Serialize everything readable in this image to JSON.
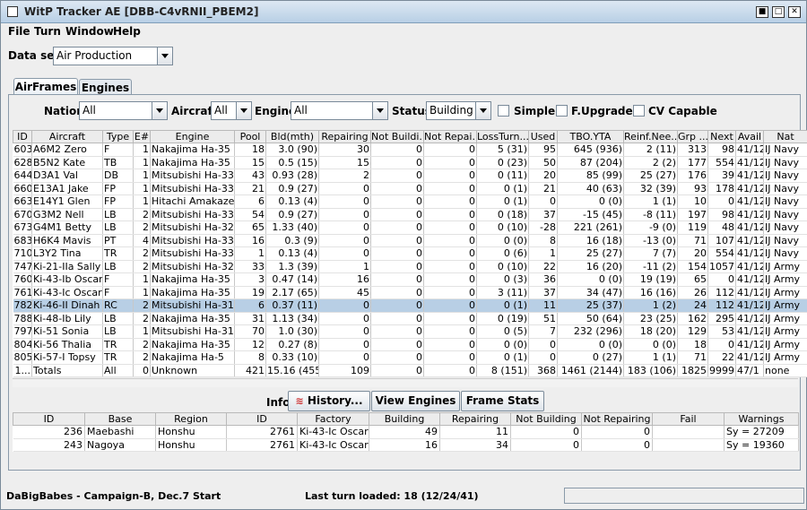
{
  "window": {
    "title": "WitP Tracker AE [DBB-C4vRNII_PBEM2]"
  },
  "menu": [
    "File",
    "Turn",
    "Window",
    "Help"
  ],
  "dataset": {
    "label": "Data set:",
    "value": "Air Production"
  },
  "tabs": [
    {
      "label": "AirFrames",
      "selected": true
    },
    {
      "label": "Engines",
      "selected": false
    }
  ],
  "filters": {
    "nation_label": "Nation:",
    "nation_value": "All",
    "aircraft_label": "Aircraft:",
    "aircraft_value": "All",
    "engine_label": "Engine:",
    "engine_value": "All",
    "status_label": "Status:",
    "status_value": "Building",
    "simple_label": "Simple",
    "fupgrades_label": "F.Upgrades",
    "cvcapable_label": "CV Capable"
  },
  "table": {
    "columns": [
      "ID",
      "Aircraft",
      "Type",
      "E#",
      "Engine",
      "Pool",
      "Bld(mth)",
      "Repairing",
      "Not Buildi...",
      "Not Repai...",
      "LossTurn...",
      "Used",
      "TBO.YTA",
      "Reinf.Nee...",
      "Grp ...",
      "Next",
      "Avail",
      "Nat"
    ],
    "selected_row": 12,
    "rows": [
      [
        "603",
        "A6M2 Zero",
        "F",
        "1",
        "Nakajima Ha-35",
        "18",
        "3.0 (90)",
        "30",
        "0",
        "0",
        "5 (31)",
        "95",
        "645 (936)",
        "2 (11)",
        "313",
        "98",
        "41/12",
        "IJ Navy"
      ],
      [
        "628",
        "B5N2 Kate",
        "TB",
        "1",
        "Nakajima Ha-35",
        "15",
        "0.5 (15)",
        "15",
        "0",
        "0",
        "0 (23)",
        "50",
        "87 (204)",
        "2 (2)",
        "177",
        "554",
        "41/12",
        "IJ Navy"
      ],
      [
        "644",
        "D3A1 Val",
        "DB",
        "1",
        "Mitsubishi Ha-33",
        "43",
        "0.93 (28)",
        "2",
        "0",
        "0",
        "0 (11)",
        "20",
        "85 (99)",
        "25 (27)",
        "176",
        "39",
        "41/12",
        "IJ Navy"
      ],
      [
        "660",
        "E13A1 Jake",
        "FP",
        "1",
        "Mitsubishi Ha-33",
        "21",
        "0.9 (27)",
        "0",
        "0",
        "0",
        "0 (1)",
        "21",
        "40 (63)",
        "32 (39)",
        "93",
        "178",
        "41/12",
        "IJ Navy"
      ],
      [
        "663",
        "E14Y1 Glen",
        "FP",
        "1",
        "Hitachi Amakaze",
        "6",
        "0.13 (4)",
        "0",
        "0",
        "0",
        "0 (1)",
        "0",
        "0 (0)",
        "1 (1)",
        "10",
        "0",
        "41/12",
        "IJ Navy"
      ],
      [
        "670",
        "G3M2 Nell",
        "LB",
        "2",
        "Mitsubishi Ha-33",
        "54",
        "0.9 (27)",
        "0",
        "0",
        "0",
        "0 (18)",
        "37",
        "-15 (45)",
        "-8 (11)",
        "197",
        "98",
        "41/12",
        "IJ Navy"
      ],
      [
        "673",
        "G4M1 Betty",
        "LB",
        "2",
        "Mitsubishi Ha-32",
        "65",
        "1.33 (40)",
        "0",
        "0",
        "0",
        "0 (10)",
        "-28",
        "221 (261)",
        "-9 (0)",
        "119",
        "48",
        "41/12",
        "IJ Navy"
      ],
      [
        "683",
        "H6K4 Mavis",
        "PT",
        "4",
        "Mitsubishi Ha-33",
        "16",
        "0.3 (9)",
        "0",
        "0",
        "0",
        "0 (0)",
        "8",
        "16 (18)",
        "-13 (0)",
        "71",
        "107",
        "41/12",
        "IJ Navy"
      ],
      [
        "710",
        "L3Y2 Tina",
        "TR",
        "2",
        "Mitsubishi Ha-33",
        "1",
        "0.13 (4)",
        "0",
        "0",
        "0",
        "0 (6)",
        "1",
        "25 (27)",
        "7 (7)",
        "20",
        "554",
        "41/12",
        "IJ Navy"
      ],
      [
        "747",
        "Ki-21-IIa Sally",
        "LB",
        "2",
        "Mitsubishi Ha-32",
        "33",
        "1.3 (39)",
        "1",
        "0",
        "0",
        "0 (10)",
        "22",
        "16 (20)",
        "-11 (2)",
        "154",
        "1057",
        "41/12",
        "IJ Army"
      ],
      [
        "760",
        "Ki-43-Ib Oscar",
        "F",
        "1",
        "Nakajima Ha-35",
        "3",
        "0.47 (14)",
        "16",
        "0",
        "0",
        "0 (3)",
        "36",
        "0 (0)",
        "19 (19)",
        "65",
        "0",
        "41/12",
        "IJ Army"
      ],
      [
        "761",
        "Ki-43-Ic Oscar",
        "F",
        "1",
        "Nakajima Ha-35",
        "19",
        "2.17 (65)",
        "45",
        "0",
        "0",
        "3 (11)",
        "37",
        "34 (47)",
        "16 (16)",
        "26",
        "112",
        "41/12",
        "IJ Army"
      ],
      [
        "782",
        "Ki-46-II Dinah",
        "RC",
        "2",
        "Mitsubishi Ha-31",
        "6",
        "0.37 (11)",
        "0",
        "0",
        "0",
        "0 (1)",
        "11",
        "25 (37)",
        "1 (2)",
        "24",
        "112",
        "41/12",
        "IJ Army"
      ],
      [
        "788",
        "Ki-48-Ib Lily",
        "LB",
        "2",
        "Nakajima Ha-35",
        "31",
        "1.13 (34)",
        "0",
        "0",
        "0",
        "0 (19)",
        "51",
        "50 (64)",
        "23 (25)",
        "162",
        "295",
        "41/12",
        "IJ Army"
      ],
      [
        "797",
        "Ki-51 Sonia",
        "LB",
        "1",
        "Mitsubishi Ha-31",
        "70",
        "1.0 (30)",
        "0",
        "0",
        "0",
        "0 (5)",
        "7",
        "232 (296)",
        "18 (20)",
        "129",
        "53",
        "41/12",
        "IJ Army"
      ],
      [
        "804",
        "Ki-56 Thalia",
        "TR",
        "2",
        "Nakajima Ha-35",
        "12",
        "0.27 (8)",
        "0",
        "0",
        "0",
        "0 (0)",
        "0",
        "0 (0)",
        "0 (0)",
        "18",
        "0",
        "41/12",
        "IJ Army"
      ],
      [
        "805",
        "Ki-57-I Topsy",
        "TR",
        "2",
        "Nakajima Ha-5",
        "8",
        "0.33 (10)",
        "0",
        "0",
        "0",
        "0 (1)",
        "0",
        "0 (27)",
        "1 (1)",
        "71",
        "22",
        "41/12",
        "IJ Army"
      ],
      [
        "1...",
        "Totals",
        "All",
        "0",
        "Unknown",
        "421",
        "15.16 (455)",
        "109",
        "0",
        "0",
        "8 (151)",
        "368",
        "1461 (2144)",
        "183 (106)",
        "1825",
        "9999",
        "47/1",
        "none"
      ]
    ]
  },
  "info": {
    "label": "Info:",
    "history_label": "History...",
    "view_engines_label": "View Engines",
    "frame_stats_label": "Frame Stats"
  },
  "factory_table": {
    "columns": [
      "ID",
      "Base",
      "Region",
      "ID",
      "Factory",
      "Building",
      "Repairing",
      "Not Building",
      "Not Repairing",
      "Fail",
      "Warnings"
    ],
    "rows": [
      [
        "236",
        "Maebashi",
        "Honshu",
        "2761",
        "Ki-43-Ic Oscar",
        "49",
        "11",
        "0",
        "0",
        "",
        "Sy = 27209"
      ],
      [
        "243",
        "Nagoya",
        "Honshu",
        "2761",
        "Ki-43-Ic Oscar",
        "16",
        "34",
        "0",
        "0",
        "",
        "Sy = 19360"
      ]
    ]
  },
  "status": {
    "campaign": "DaBigBabes - Campaign-B, Dec.7 Start",
    "last_turn": "Last turn loaded: 18 (12/24/41)"
  }
}
